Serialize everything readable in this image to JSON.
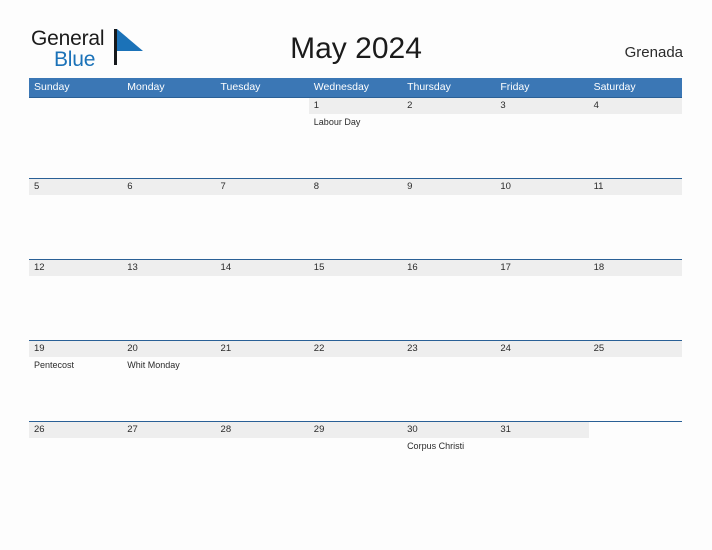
{
  "brand": {
    "name_part1": "General",
    "name_part2": "Blue",
    "accent_color": "#1b72b8",
    "triangle_icon": "blue-triangle-icon"
  },
  "header": {
    "title": "May 2024",
    "country": "Grenada"
  },
  "calendar": {
    "month": "May",
    "year": "2024",
    "weekday_headers": [
      "Sunday",
      "Monday",
      "Tuesday",
      "Wednesday",
      "Thursday",
      "Friday",
      "Saturday"
    ],
    "header_bg_color": "#3b77b5",
    "row_band_color": "#eeeeee",
    "row_rule_color": "#2a6096",
    "weeks": [
      {
        "days": [
          {
            "num": "",
            "event": ""
          },
          {
            "num": "",
            "event": ""
          },
          {
            "num": "",
            "event": ""
          },
          {
            "num": "1",
            "event": "Labour Day"
          },
          {
            "num": "2",
            "event": ""
          },
          {
            "num": "3",
            "event": ""
          },
          {
            "num": "4",
            "event": ""
          }
        ]
      },
      {
        "days": [
          {
            "num": "5",
            "event": ""
          },
          {
            "num": "6",
            "event": ""
          },
          {
            "num": "7",
            "event": ""
          },
          {
            "num": "8",
            "event": ""
          },
          {
            "num": "9",
            "event": ""
          },
          {
            "num": "10",
            "event": ""
          },
          {
            "num": "11",
            "event": ""
          }
        ]
      },
      {
        "days": [
          {
            "num": "12",
            "event": ""
          },
          {
            "num": "13",
            "event": ""
          },
          {
            "num": "14",
            "event": ""
          },
          {
            "num": "15",
            "event": ""
          },
          {
            "num": "16",
            "event": ""
          },
          {
            "num": "17",
            "event": ""
          },
          {
            "num": "18",
            "event": ""
          }
        ]
      },
      {
        "days": [
          {
            "num": "19",
            "event": "Pentecost"
          },
          {
            "num": "20",
            "event": "Whit Monday"
          },
          {
            "num": "21",
            "event": ""
          },
          {
            "num": "22",
            "event": ""
          },
          {
            "num": "23",
            "event": ""
          },
          {
            "num": "24",
            "event": ""
          },
          {
            "num": "25",
            "event": ""
          }
        ]
      },
      {
        "days": [
          {
            "num": "26",
            "event": ""
          },
          {
            "num": "27",
            "event": ""
          },
          {
            "num": "28",
            "event": ""
          },
          {
            "num": "29",
            "event": ""
          },
          {
            "num": "30",
            "event": "Corpus Christi"
          },
          {
            "num": "31",
            "event": ""
          },
          {
            "num": "",
            "event": ""
          }
        ]
      }
    ]
  }
}
